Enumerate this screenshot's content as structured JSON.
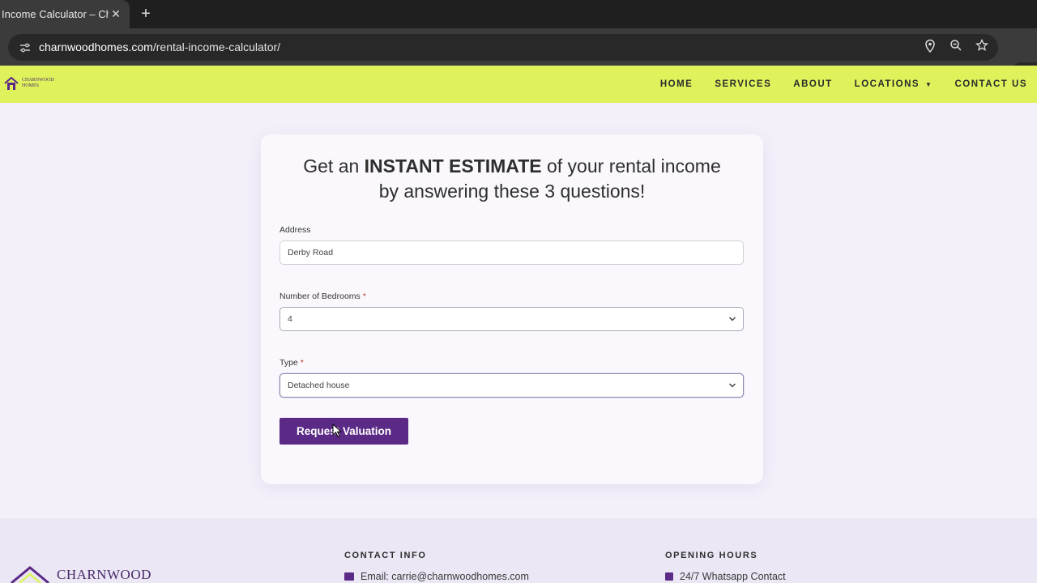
{
  "browser": {
    "tab_title": "Income Calculator – Cha",
    "tab_close": "✕",
    "new_tab": "+",
    "url_host": "charnwoodhomes.com",
    "url_path": "/rental-income-calculator/"
  },
  "site": {
    "logo_line1": "CHARNWOOD",
    "logo_line2": "HOMES",
    "nav": {
      "home": "HOME",
      "services": "SERVICES",
      "about": "ABOUT",
      "locations": "LOCATIONS",
      "contact": "CONTACT US"
    }
  },
  "form": {
    "headline_pre": "Get an ",
    "headline_bold": "INSTANT ESTIMATE",
    "headline_post": " of your rental income",
    "headline_line2": "by answering these 3 questions!",
    "address_label": "Address",
    "address_value": "Derby Road",
    "bedrooms_label": "Number of Bedrooms",
    "bedrooms_value": "4",
    "type_label": "Type",
    "type_value": "Detached house",
    "required_mark": "*",
    "submit_label": "Request Valuation"
  },
  "footer": {
    "logo_text": "CHARNWOOD",
    "contact_heading": "CONTACT INFO",
    "contact_email": "Email: carrie@charnwoodhomes.com",
    "hours_heading": "OPENING HOURS",
    "hours_line": "24/7 Whatsapp Contact"
  },
  "colors": {
    "header_bg": "#dff25c",
    "brand_purple": "#5b2a86",
    "page_bg": "#f3f0fa"
  },
  "icons": [
    "close-icon",
    "plus-icon",
    "site-settings-icon",
    "location-icon",
    "zoom-icon",
    "star-icon",
    "extension-icon",
    "chevron-down-icon",
    "email-icon",
    "calendar-icon",
    "cursor-icon"
  ]
}
